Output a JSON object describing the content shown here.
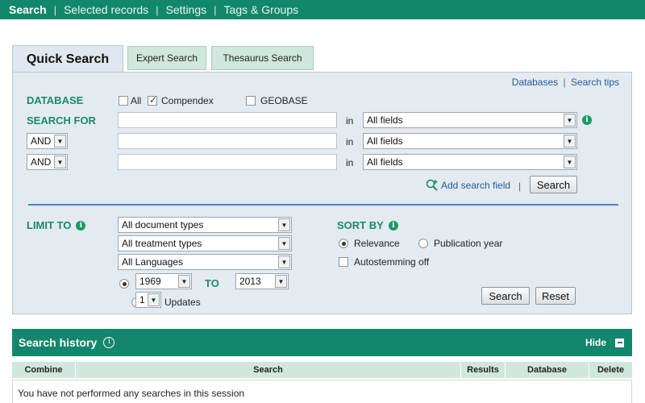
{
  "nav": {
    "items": [
      {
        "label": "Search",
        "active": true
      },
      {
        "label": "Selected records",
        "active": false
      },
      {
        "label": "Settings",
        "active": false
      },
      {
        "label": "Tags & Groups",
        "active": false
      }
    ],
    "separator": "|"
  },
  "tabs": {
    "quick": "Quick Search",
    "expert": "Expert Search",
    "thesaurus": "Thesaurus Search"
  },
  "links": {
    "databases": "Databases",
    "separator": "|",
    "search_tips": "Search tips"
  },
  "database": {
    "label": "DATABASE",
    "options": [
      {
        "label": "All",
        "checked": false
      },
      {
        "label": "Compendex",
        "checked": true
      },
      {
        "label": "GEOBASE",
        "checked": false
      }
    ]
  },
  "search_for": {
    "label": "SEARCH FOR",
    "in_label": "in",
    "rows": [
      {
        "operator": "",
        "value": "",
        "field": "All fields"
      },
      {
        "operator": "AND",
        "value": "",
        "field": "All fields"
      },
      {
        "operator": "AND",
        "value": "",
        "field": "All fields"
      }
    ],
    "add_field": "Add search field",
    "add_sep": "|",
    "search_button": "Search"
  },
  "limit_to": {
    "label": "LIMIT TO",
    "document_types": "All document types",
    "treatment_types": "All treatment types",
    "languages": "All Languages",
    "year_from": "1969",
    "to_label": "TO",
    "year_to": "2013",
    "updates_value": "1",
    "updates_label": "Updates"
  },
  "sort_by": {
    "label": "SORT BY",
    "options": [
      {
        "label": "Relevance",
        "checked": true
      },
      {
        "label": "Publication year",
        "checked": false
      }
    ],
    "autostemming": "Autostemming off"
  },
  "actions": {
    "search": "Search",
    "reset": "Reset"
  },
  "history": {
    "title": "Search history",
    "hide": "Hide",
    "columns": [
      "Combine",
      "Search",
      "Results",
      "Database",
      "Delete"
    ],
    "empty_message": "You have not performed any searches in this session"
  },
  "colors": {
    "brand_green": "#13876c",
    "label_green": "#1a8a6a",
    "panel_bg": "#e3ebf1",
    "link_blue": "#1e5a9c"
  }
}
